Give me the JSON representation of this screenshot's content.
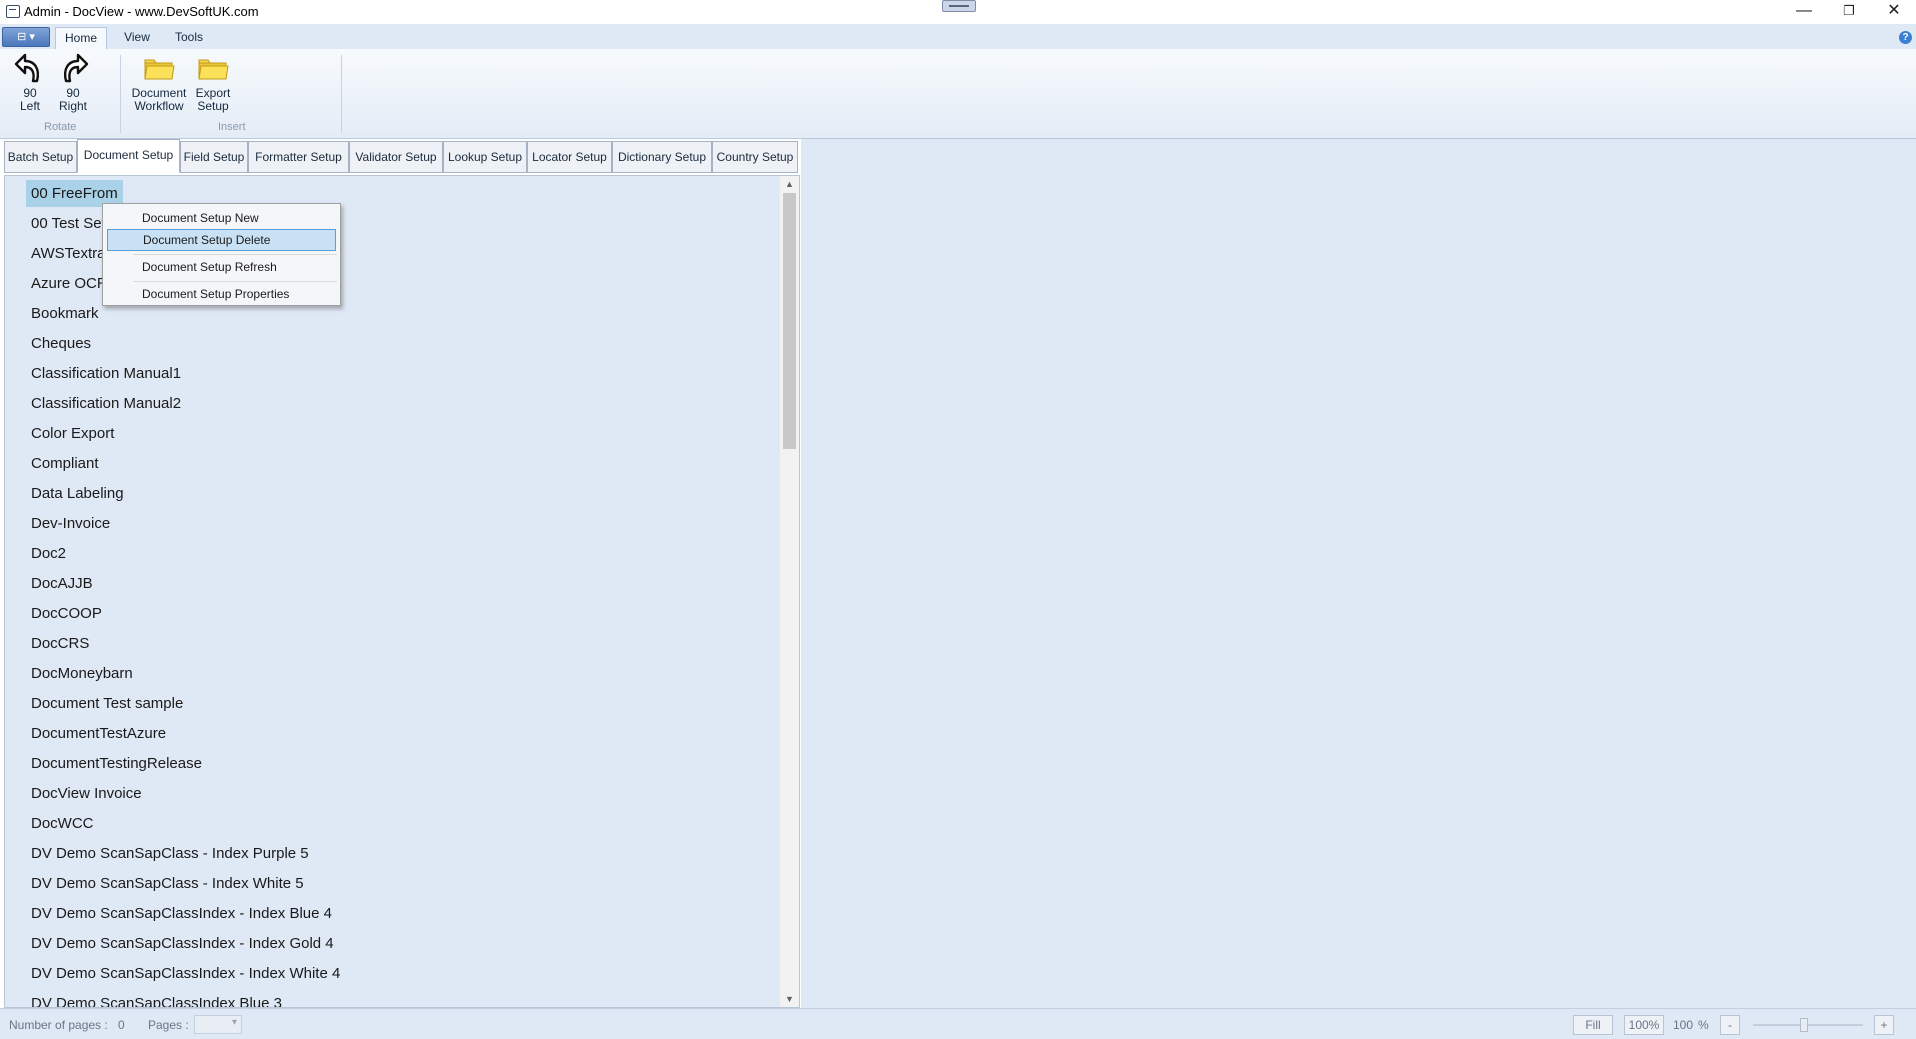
{
  "window": {
    "title": "Admin - DocView - www.DevSoftUK.com",
    "minimize_glyph": "—",
    "restore_glyph": "❐",
    "close_glyph": "✕"
  },
  "ribbon_tabs": {
    "app_menu_glyph": "▾",
    "tabs": [
      "Home",
      "View",
      "Tools"
    ],
    "active": "Home"
  },
  "ribbon": {
    "buttons": [
      {
        "line1": "90",
        "line2": "Left",
        "icon": "rotate-left-icon"
      },
      {
        "line1": "90",
        "line2": "Right",
        "icon": "rotate-right-icon"
      },
      {
        "line1": "Document",
        "line2": "Workflow",
        "icon": "folder-icon"
      },
      {
        "line1": "Export",
        "line2": "Setup",
        "icon": "folder-icon"
      }
    ],
    "groups": [
      "Rotate",
      "Insert"
    ]
  },
  "setup_tabs": {
    "tabs": [
      "Batch Setup",
      "Document Setup",
      "Field Setup",
      "Formatter Setup",
      "Validator Setup",
      "Lookup Setup",
      "Locator Setup",
      "Dictionary Setup",
      "Country Setup"
    ],
    "active": "Document Setup"
  },
  "document_list": {
    "selected": "00 FreeFrom",
    "items": [
      "00 FreeFrom",
      "00 Test Set",
      "AWSTextra",
      "Azure OCR",
      "Bookmark",
      "Cheques",
      "Classification Manual1",
      "Classification Manual2",
      "Color Export",
      "Compliant",
      "Data Labeling",
      "Dev-Invoice",
      "Doc2",
      "DocAJJB",
      "DocCOOP",
      "DocCRS",
      "DocMoneybarn",
      "Document Test sample",
      "DocumentTestAzure",
      "DocumentTestingRelease",
      "DocView Invoice",
      "DocWCC",
      "DV Demo ScanSapClass - Index Purple 5",
      "DV Demo ScanSapClass - Index White 5",
      "DV Demo ScanSapClassIndex - Index  Blue 4",
      "DV Demo ScanSapClassIndex - Index  Gold 4",
      "DV Demo ScanSapClassIndex - Index  White 4",
      "DV Demo ScanSapClassIndex Blue 3"
    ]
  },
  "context_menu": {
    "items": [
      "Document Setup New",
      "Document Setup Delete",
      "Document Setup Refresh",
      "Document Setup Properties"
    ],
    "highlighted": "Document Setup Delete"
  },
  "status_bar": {
    "number_of_pages_label": "Number of pages :",
    "number_of_pages_value": "0",
    "pages_label": "Pages :",
    "fill_label": "Fill",
    "hundred_button": "100%",
    "zoom_value": "100",
    "zoom_unit": "%",
    "zoom_out": "-",
    "zoom_in": "+"
  },
  "colors": {
    "panel_bg": "#dfe8f5",
    "selected_item": "#a9d2e8",
    "menu_highlight": "#c9e1f4"
  }
}
